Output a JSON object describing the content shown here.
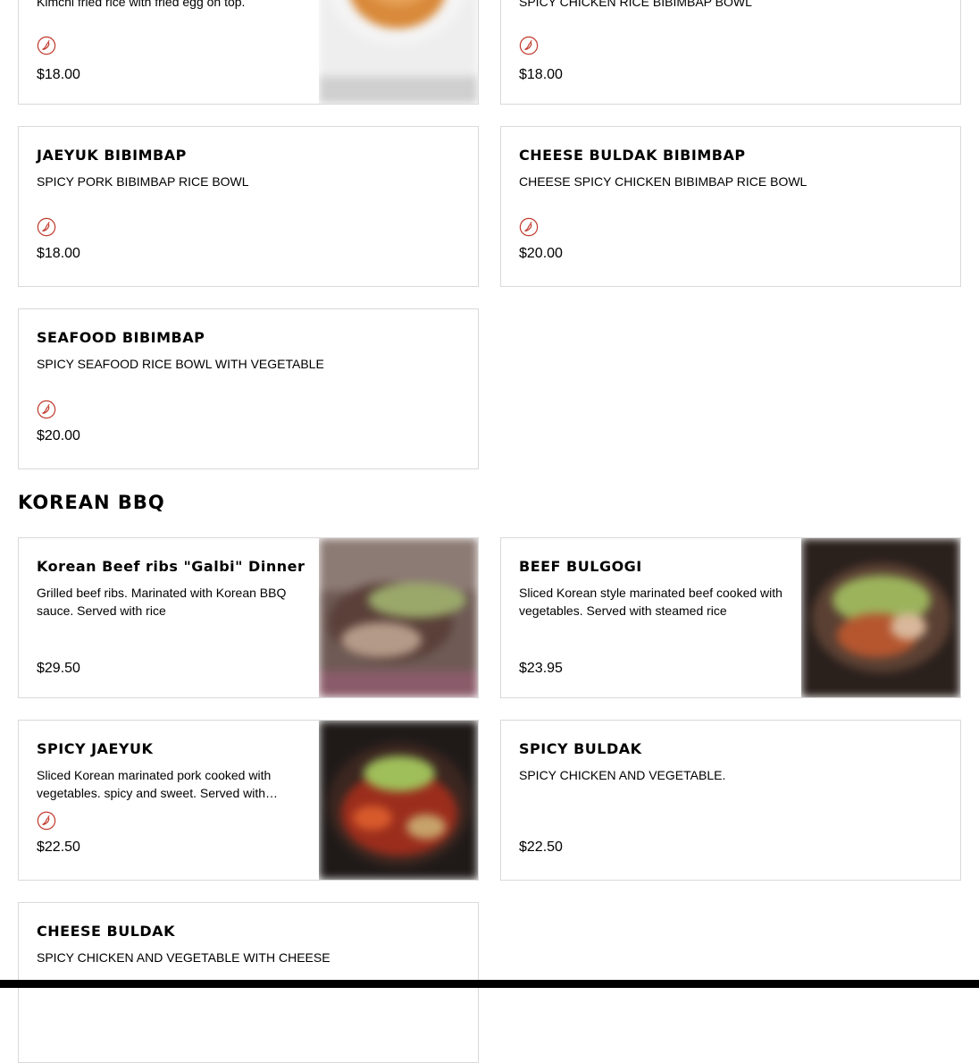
{
  "top_items": [
    {
      "desc": "Kimchi fried rice with fried egg on top.",
      "price": "$18.00",
      "spicy": true,
      "image": "kimchi-fried-rice-photo"
    },
    {
      "desc": "SPICY CHICKEN RICE BIBIMBAP BOWL",
      "price": "$18.00",
      "spicy": true
    }
  ],
  "bibimbap_items": [
    {
      "name": "JAEYUK BIBIMBAP",
      "desc": "SPICY PORK BIBIMBAP RICE BOWL",
      "price": "$18.00",
      "spicy": true
    },
    {
      "name": "CHEESE BULDAK BIBIMBAP",
      "desc": "CHEESE SPICY CHICKEN BIBIMBAP RICE BOWL",
      "price": "$20.00",
      "spicy": true
    },
    {
      "name": "SEAFOOD BIBIMBAP",
      "desc": "SPICY SEAFOOD RICE BOWL WITH VEGETABLE",
      "price": "$20.00",
      "spicy": true
    }
  ],
  "korean_bbq": {
    "title": "KOREAN BBQ",
    "items": [
      {
        "name": "Korean Beef ribs \"Galbi\" Dinner",
        "desc": "Grilled beef ribs. Marinated with Korean BBQ sauce. Served with rice",
        "price": "$29.50",
        "spicy": false,
        "image": "galbi-photo"
      },
      {
        "name": "BEEF BULGOGI",
        "desc": "Sliced Korean style marinated beef cooked with vegetables. Served with steamed rice",
        "price": "$23.95",
        "spicy": false,
        "image": "bulgogi-photo"
      },
      {
        "name": "SPICY JAEYUK",
        "desc": "Sliced Korean marinated pork cooked with vegetables. spicy and sweet. Served with…",
        "price": "$22.50",
        "spicy": true,
        "image": "spicy-jaeyuk-photo"
      },
      {
        "name": "SPICY BULDAK",
        "desc": "SPICY CHICKEN AND VEGETABLE.",
        "price": "$22.50",
        "spicy": false
      },
      {
        "name": "CHEESE BULDAK",
        "desc": "SPICY CHICKEN AND VEGETABLE WITH CHEESE"
      }
    ]
  },
  "icons": {
    "spicy": "chili-pepper-icon"
  },
  "colors": {
    "spicy_icon": "#c0392b",
    "card_border": "#d9d9d9",
    "bottom_bar": "#000000"
  }
}
